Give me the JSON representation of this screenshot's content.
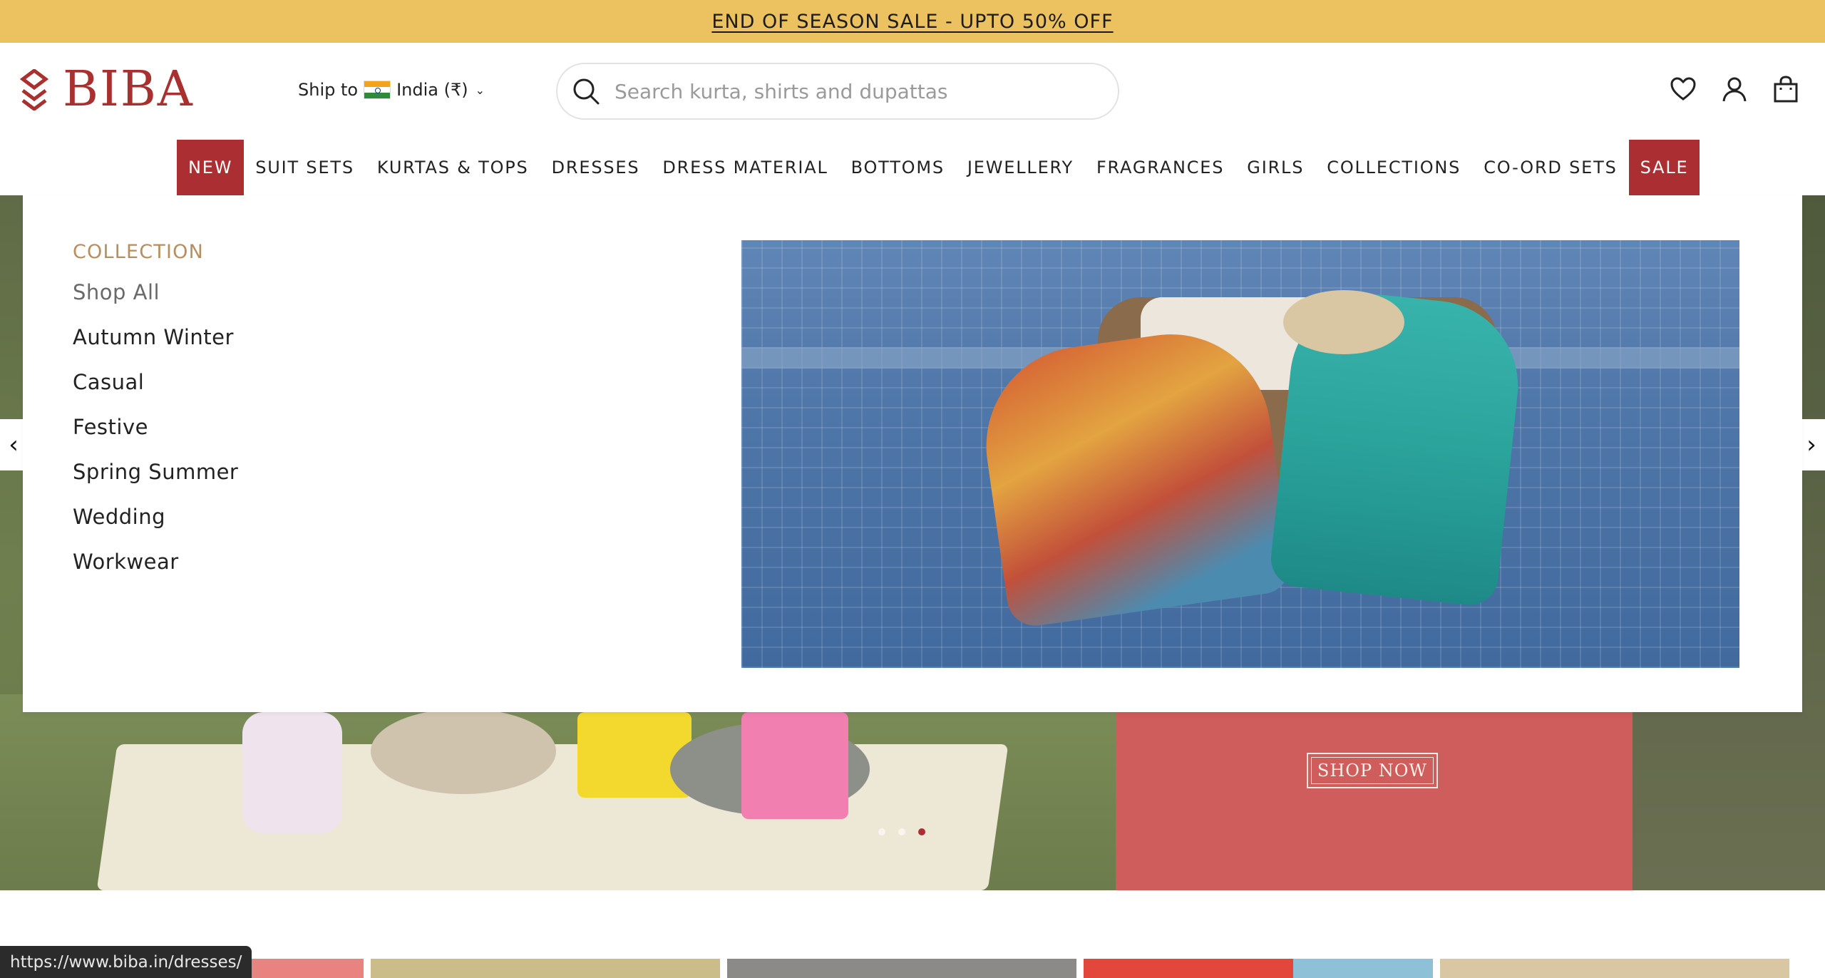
{
  "promo": {
    "text": "END OF SEASON SALE - UPTO 50% OFF"
  },
  "brand": {
    "name": "BIBA",
    "color": "#a8312f"
  },
  "shipping": {
    "label": "Ship to",
    "country": "India (₹)"
  },
  "search": {
    "placeholder": "Search kurta, shirts and dupattas"
  },
  "header_icons": [
    "heart-icon",
    "user-icon",
    "bag-icon"
  ],
  "nav": {
    "items": [
      {
        "label": "NEW",
        "highlight": true
      },
      {
        "label": "SUIT SETS"
      },
      {
        "label": "KURTAS & TOPS"
      },
      {
        "label": "DRESSES",
        "active": true
      },
      {
        "label": "DRESS MATERIAL"
      },
      {
        "label": "BOTTOMS"
      },
      {
        "label": "JEWELLERY"
      },
      {
        "label": "FRAGRANCES"
      },
      {
        "label": "GIRLS"
      },
      {
        "label": "COLLECTIONS"
      },
      {
        "label": "CO-ORD SETS"
      },
      {
        "label": "SALE",
        "highlight": true
      }
    ]
  },
  "mega_menu": {
    "heading": "COLLECTION",
    "links": [
      "Shop All",
      "Autumn Winter",
      "Casual",
      "Festive",
      "Spring Summer",
      "Wedding",
      "Workwear"
    ]
  },
  "hero": {
    "cta": "SHOP NOW",
    "slides": 3,
    "active_slide": 3
  },
  "status_bar": {
    "url": "https://www.biba.in/dresses/"
  },
  "colors": {
    "promo_bg": "#ecc15f",
    "accent": "#ab2f32",
    "collection_heading": "#b78e5e"
  }
}
